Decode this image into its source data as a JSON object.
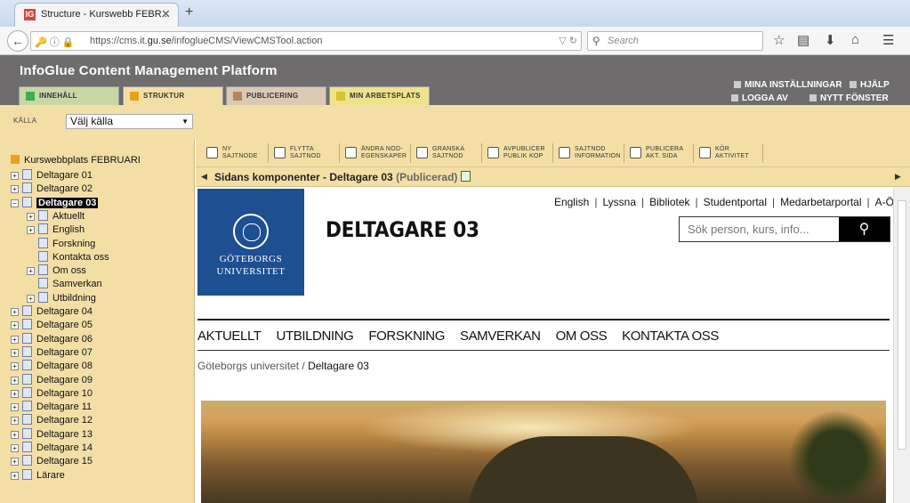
{
  "browser": {
    "tab_title": "Structure - Kurswebb FEBR...",
    "tab_favicon": "IG",
    "url_prefix": "https://cms.it.",
    "url_domain": "gu.se",
    "url_path": "/infoglueCMS/ViewCMSTool.action",
    "search_placeholder": "Search"
  },
  "cms": {
    "title": "InfoGlue Content Management Platform",
    "links": {
      "settings": "MINA INSTÄLLNINGAR",
      "help": "HJÄLP",
      "logout": "LOGGA AV",
      "new_window": "NYTT FÖNSTER"
    },
    "tabs": [
      {
        "label": "INNEHÅLL",
        "color": "#c9d6a6",
        "icon_color": "#3bb14a"
      },
      {
        "label": "STRUKTUR",
        "color": "#f3dfa6",
        "icon_color": "#e8a11a"
      },
      {
        "label": "PUBLICERING",
        "color": "#dcc9b4",
        "icon_color": "#b3865e"
      },
      {
        "label": "MIN ARBETSPLATS",
        "color": "#efe28d",
        "icon_color": "#d2c330"
      }
    ],
    "source_label": "KÄLLA",
    "source_value": "Välj källa"
  },
  "tree": {
    "root": "Kurswebbplats FEBRUARI",
    "items": [
      {
        "label": "Deltagare 01",
        "level": 0
      },
      {
        "label": "Deltagare 02",
        "level": 0
      },
      {
        "label": "Deltagare 03",
        "level": 0,
        "selected": true,
        "expanded": true
      },
      {
        "label": "Aktuellt",
        "level": 1
      },
      {
        "label": "English",
        "level": 1
      },
      {
        "label": "Forskning",
        "level": 1
      },
      {
        "label": "Kontakta oss",
        "level": 1
      },
      {
        "label": "Om oss",
        "level": 1
      },
      {
        "label": "Samverkan",
        "level": 1
      },
      {
        "label": "Utbildning",
        "level": 1
      },
      {
        "label": "Deltagare 04",
        "level": 0
      },
      {
        "label": "Deltagare 05",
        "level": 0
      },
      {
        "label": "Deltagare 06",
        "level": 0
      },
      {
        "label": "Deltagare 07",
        "level": 0
      },
      {
        "label": "Deltagare 08",
        "level": 0
      },
      {
        "label": "Deltagare 09",
        "level": 0
      },
      {
        "label": "Deltagare 10",
        "level": 0
      },
      {
        "label": "Deltagare 11",
        "level": 0
      },
      {
        "label": "Deltagare 12",
        "level": 0
      },
      {
        "label": "Deltagare 13",
        "level": 0
      },
      {
        "label": "Deltagare 14",
        "level": 0
      },
      {
        "label": "Deltagare 15",
        "level": 0
      },
      {
        "label": "Lärare",
        "level": 0
      }
    ]
  },
  "toolbar": {
    "buttons": [
      {
        "l1": "NY",
        "l2": "SAJTNODE"
      },
      {
        "l1": "FLYTTA",
        "l2": "SAJTNOD"
      },
      {
        "l1": "ÄNDRA NOD-",
        "l2": "EGENSKAPER"
      },
      {
        "l1": "GRANSKA",
        "l2": "SAJTNOD"
      },
      {
        "l1": "AVPUBLICER",
        "l2": "PUBLIK KOP"
      },
      {
        "l1": "SAJTNOD",
        "l2": "INFORMATION"
      },
      {
        "l1": "PUBLICERA",
        "l2": "AKT. SIDA"
      },
      {
        "l1": "KÖR",
        "l2": "AKTIVITET"
      }
    ]
  },
  "component_bar": {
    "title": "Sidans komponenter - Deltagare 03",
    "status": "(Publicerad)"
  },
  "site": {
    "logo_line1": "GÖTEBORGS",
    "logo_line2": "UNIVERSITET",
    "page_title": "DELTAGARE 03",
    "top_links": [
      "English",
      "Lyssna",
      "Bibliotek",
      "Studentportal",
      "Medarbetarportal",
      "A-Ö"
    ],
    "search_placeholder": "Sök person, kurs, info...",
    "nav": [
      "AKTUELLT",
      "UTBILDNING",
      "FORSKNING",
      "SAMVERKAN",
      "OM OSS",
      "KONTAKTA OSS"
    ],
    "breadcrumb_root": "Göteborgs universitet",
    "breadcrumb_sep": "/",
    "breadcrumb_current": "Deltagare 03"
  }
}
